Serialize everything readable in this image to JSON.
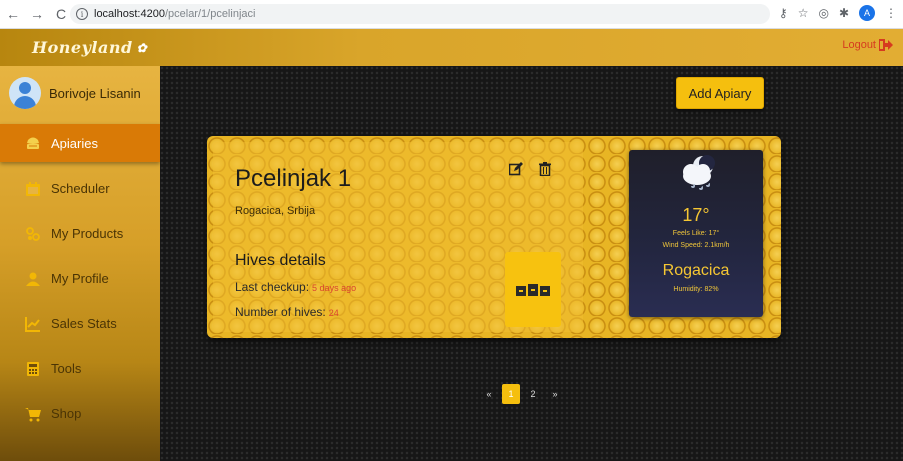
{
  "browser": {
    "url_host": "localhost:4200",
    "url_path": "/pcelar/1/pcelinjaci",
    "profile_letter": "A"
  },
  "header": {
    "brand": "Honeyland",
    "logout_label": "Logout"
  },
  "sidebar": {
    "user_name": "Borivoje Lisanin",
    "items": [
      {
        "label": "Apiaries",
        "icon": "hive-icon"
      },
      {
        "label": "Scheduler",
        "icon": "calendar-icon"
      },
      {
        "label": "My Products",
        "icon": "products-icon"
      },
      {
        "label": "My Profile",
        "icon": "user-icon"
      },
      {
        "label": "Sales Stats",
        "icon": "chart-icon"
      },
      {
        "label": "Tools",
        "icon": "calculator-icon"
      },
      {
        "label": "Shop",
        "icon": "cart-icon"
      }
    ],
    "active_index": 0
  },
  "main": {
    "add_button": "Add Apiary",
    "apiary": {
      "name": "Pcelinjak 1",
      "location": "Rogacica, Srbija",
      "hives_title": "Hives details",
      "last_checkup_label": "Last checkup:",
      "last_checkup_value": "5 days ago",
      "hives_count_label": "Number of hives:",
      "hives_count_value": "24"
    },
    "weather": {
      "temperature": "17°",
      "feels_like": "Feels Like: 17°",
      "wind": "Wind Speed: 2.1km/h",
      "city": "Rogacica",
      "humidity": "Humidity: 82%"
    },
    "pagination": {
      "prev": "«",
      "pages": [
        "1",
        "2"
      ],
      "next": "»",
      "current": "1"
    }
  },
  "colors": {
    "accent": "#f5bf0e",
    "active_nav": "#d97a06",
    "logout": "#d63b1f"
  }
}
